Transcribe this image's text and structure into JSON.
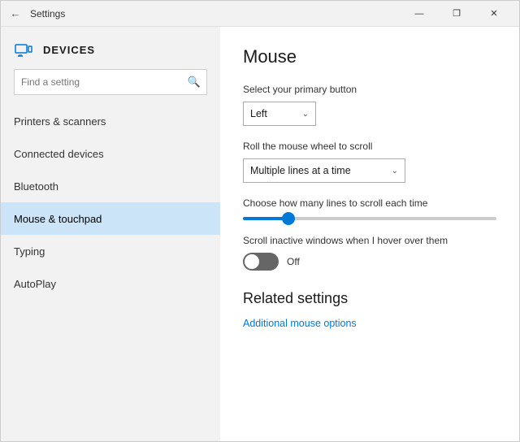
{
  "window": {
    "title": "Settings",
    "controls": {
      "minimize": "—",
      "maximize": "❐",
      "close": "✕"
    }
  },
  "sidebar": {
    "icon": "⚙",
    "heading": "DEVICES",
    "search_placeholder": "Find a setting",
    "nav_items": [
      {
        "id": "printers",
        "label": "Printers & scanners",
        "active": false
      },
      {
        "id": "connected",
        "label": "Connected devices",
        "active": false
      },
      {
        "id": "bluetooth",
        "label": "Bluetooth",
        "active": false
      },
      {
        "id": "mouse",
        "label": "Mouse & touchpad",
        "active": true
      },
      {
        "id": "typing",
        "label": "Typing",
        "active": false
      },
      {
        "id": "autoplay",
        "label": "AutoPlay",
        "active": false
      }
    ]
  },
  "main": {
    "title": "Mouse",
    "primary_button": {
      "label": "Select your primary button",
      "value": "Left"
    },
    "scroll_setting": {
      "label": "Roll the mouse wheel to scroll",
      "value": "Multiple lines at a time"
    },
    "scroll_lines": {
      "label": "Choose how many lines to scroll each time",
      "value": 18
    },
    "scroll_inactive": {
      "label": "Scroll inactive windows when I hover over them",
      "state": "Off"
    },
    "related": {
      "title": "Related settings",
      "link": "Additional mouse options"
    }
  }
}
